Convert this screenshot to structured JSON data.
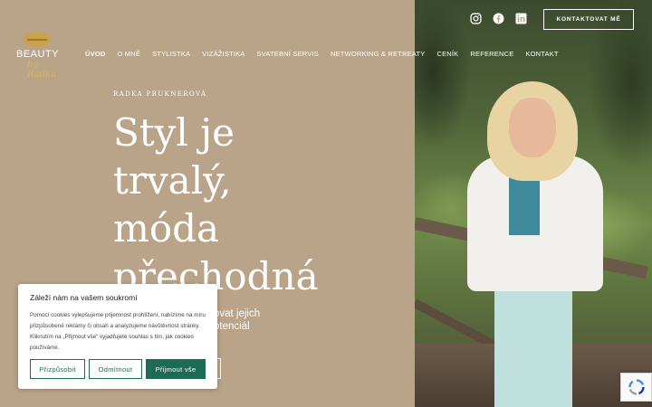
{
  "logo": {
    "word": "BEAUTY",
    "script": "by Radka"
  },
  "nav": {
    "items": [
      {
        "label": "ÚVOD",
        "active": true
      },
      {
        "label": "O MNĚ",
        "active": false
      },
      {
        "label": "STYLISTKA",
        "active": false
      },
      {
        "label": "VIZÁŽISTIKA",
        "active": false
      },
      {
        "label": "SVATEBNÍ SERVIS",
        "active": false
      },
      {
        "label": "NETWORKING & RETREATY",
        "active": false
      },
      {
        "label": "CENÍK",
        "active": false
      },
      {
        "label": "REFERENCE",
        "active": false
      },
      {
        "label": "KONTAKT",
        "active": false
      }
    ]
  },
  "header": {
    "contact_button": "KONTAKTOVAT MĚ",
    "social_icons": [
      "instagram-icon",
      "facebook-icon",
      "linkedin-icon"
    ]
  },
  "hero": {
    "eyebrow": "RADKA PRUKNEROVÁ",
    "headline_lines": [
      "Styl je",
      "trvalý,",
      "móda",
      "přechodná"
    ],
    "subtext_line1": "ovat jejich",
    "subtext_line2": "otenciál"
  },
  "cookie": {
    "title": "Záleží nám na vašem soukromí",
    "body": "Pomocí cookies vylepšujeme prijemnost prohlížení, nabízíme na míru přizpůsobené reklamy či obsah a analyzujeme návštěvnost stránky. Kliknutím na „Přijmout vše“ vyjadřujete souhlas s tím, jak cookies používáme.",
    "customize_label": "Přizpůsobit",
    "reject_label": "Odmítnout",
    "accept_label": "Přijmout vše"
  },
  "colors": {
    "background": "#b9a48a",
    "accent_green": "#1d6b55",
    "gold": "#c9a24a"
  }
}
